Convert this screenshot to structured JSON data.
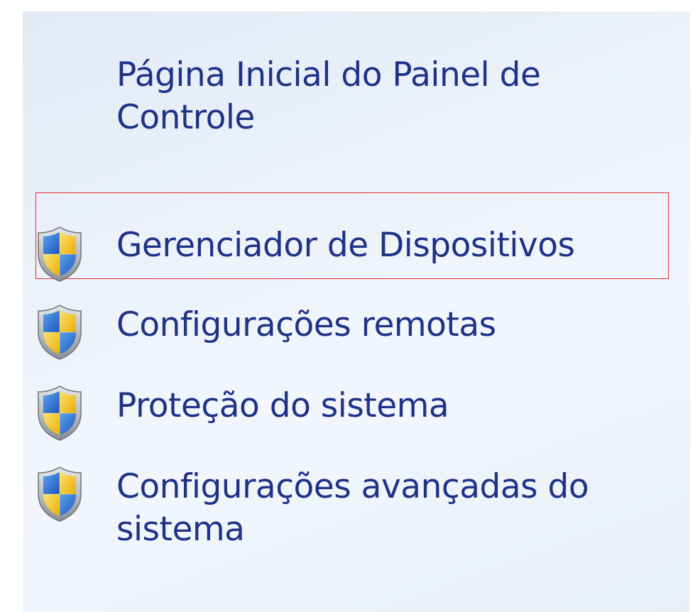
{
  "panel": {
    "home_link": "Página Inicial do Painel de Controle",
    "tasks": [
      {
        "label": "Gerenciador de Dispositivos",
        "icon": "uac-shield-icon",
        "highlighted": true
      },
      {
        "label": "Configurações remotas",
        "icon": "uac-shield-icon",
        "highlighted": false
      },
      {
        "label": "Proteção do sistema",
        "icon": "uac-shield-icon",
        "highlighted": false
      },
      {
        "label": "Configurações avançadas do sistema",
        "icon": "uac-shield-icon",
        "highlighted": false
      }
    ]
  },
  "colors": {
    "link_text": "#1e3287",
    "highlight_border": "#e53030",
    "panel_background": "#e9eff8",
    "shield_blue": "#2a6fd0",
    "shield_yellow": "#f2c21a"
  }
}
